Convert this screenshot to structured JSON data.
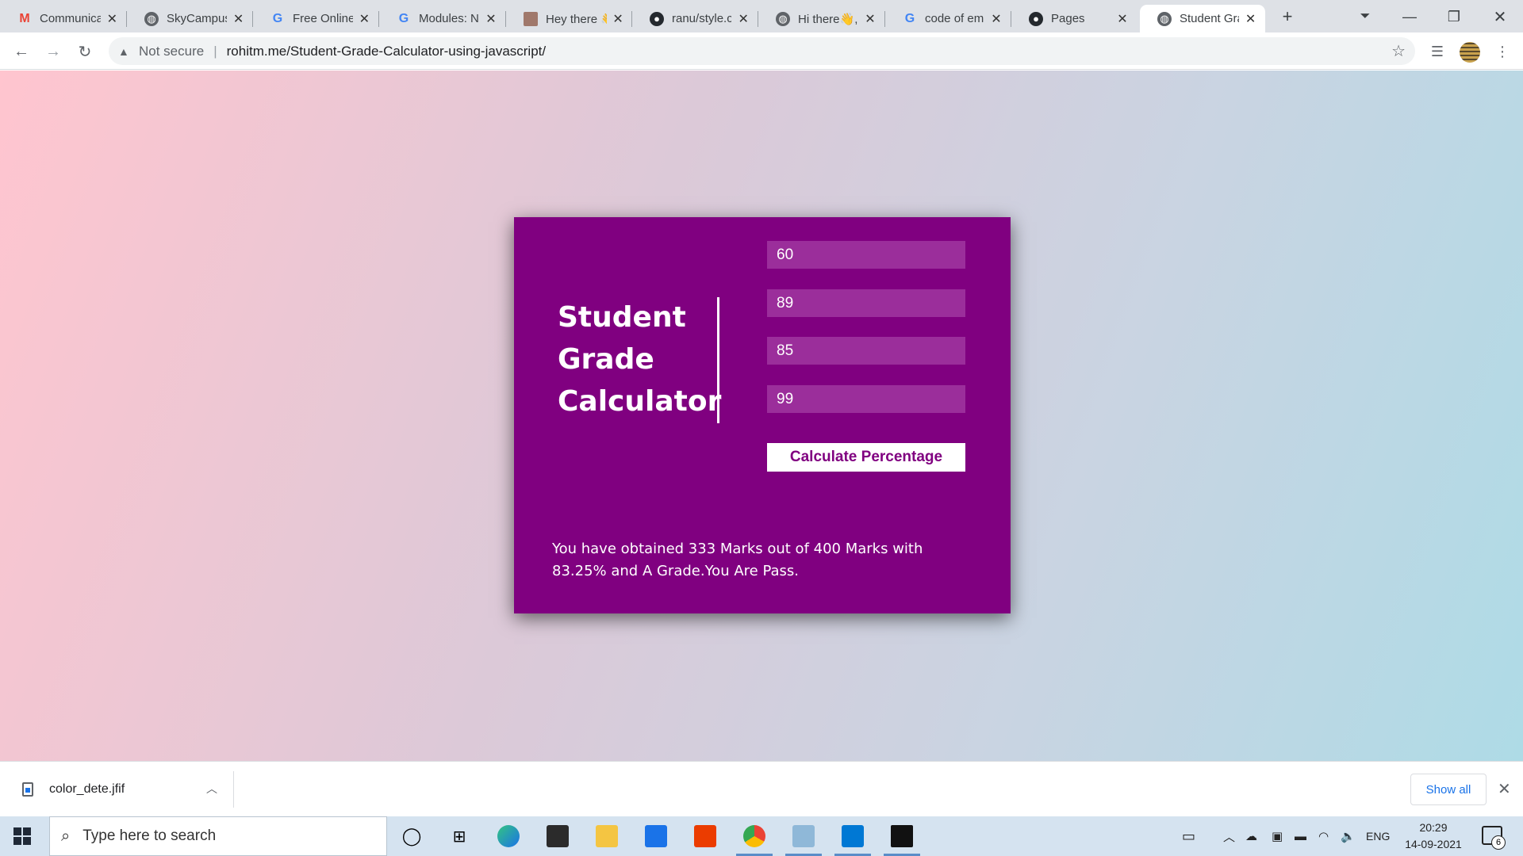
{
  "browser": {
    "tabs": [
      {
        "title": "Communica",
        "icon": "gmail-icon"
      },
      {
        "title": "SkyCampus",
        "icon": "globe-icon"
      },
      {
        "title": "Free Online",
        "icon": "google-icon"
      },
      {
        "title": "Modules: N",
        "icon": "google-icon"
      },
      {
        "title": "Hey there 👋",
        "icon": "image-icon"
      },
      {
        "title": "ranu/style.c",
        "icon": "github-icon"
      },
      {
        "title": "Hi there👋,",
        "icon": "globe-icon"
      },
      {
        "title": "code of em",
        "icon": "google-icon"
      },
      {
        "title": "Pages",
        "icon": "github-icon"
      },
      {
        "title": "Student Gra",
        "icon": "globe-icon"
      }
    ],
    "security_label": "Not secure",
    "url": "rohitm.me/Student-Grade-Calculator-using-javascript/"
  },
  "page": {
    "title_lines": [
      "Student",
      "Grade",
      "Calculator"
    ],
    "marks": [
      "60",
      "89",
      "85",
      "99"
    ],
    "calculate_button": "Calculate Percentage",
    "result": "You have obtained 333 Marks out of 400 Marks with 83.25% and A Grade.You Are Pass.",
    "colors": {
      "card": "#800080",
      "input": "#9b2e9b",
      "text": "#ffffff"
    }
  },
  "downloads": {
    "file_name": "color_dete.jfif",
    "show_all": "Show all"
  },
  "taskbar": {
    "search_placeholder": "Type here to search",
    "language": "ENG",
    "time": "20:29",
    "date": "14-09-2021",
    "notification_count": "6"
  }
}
